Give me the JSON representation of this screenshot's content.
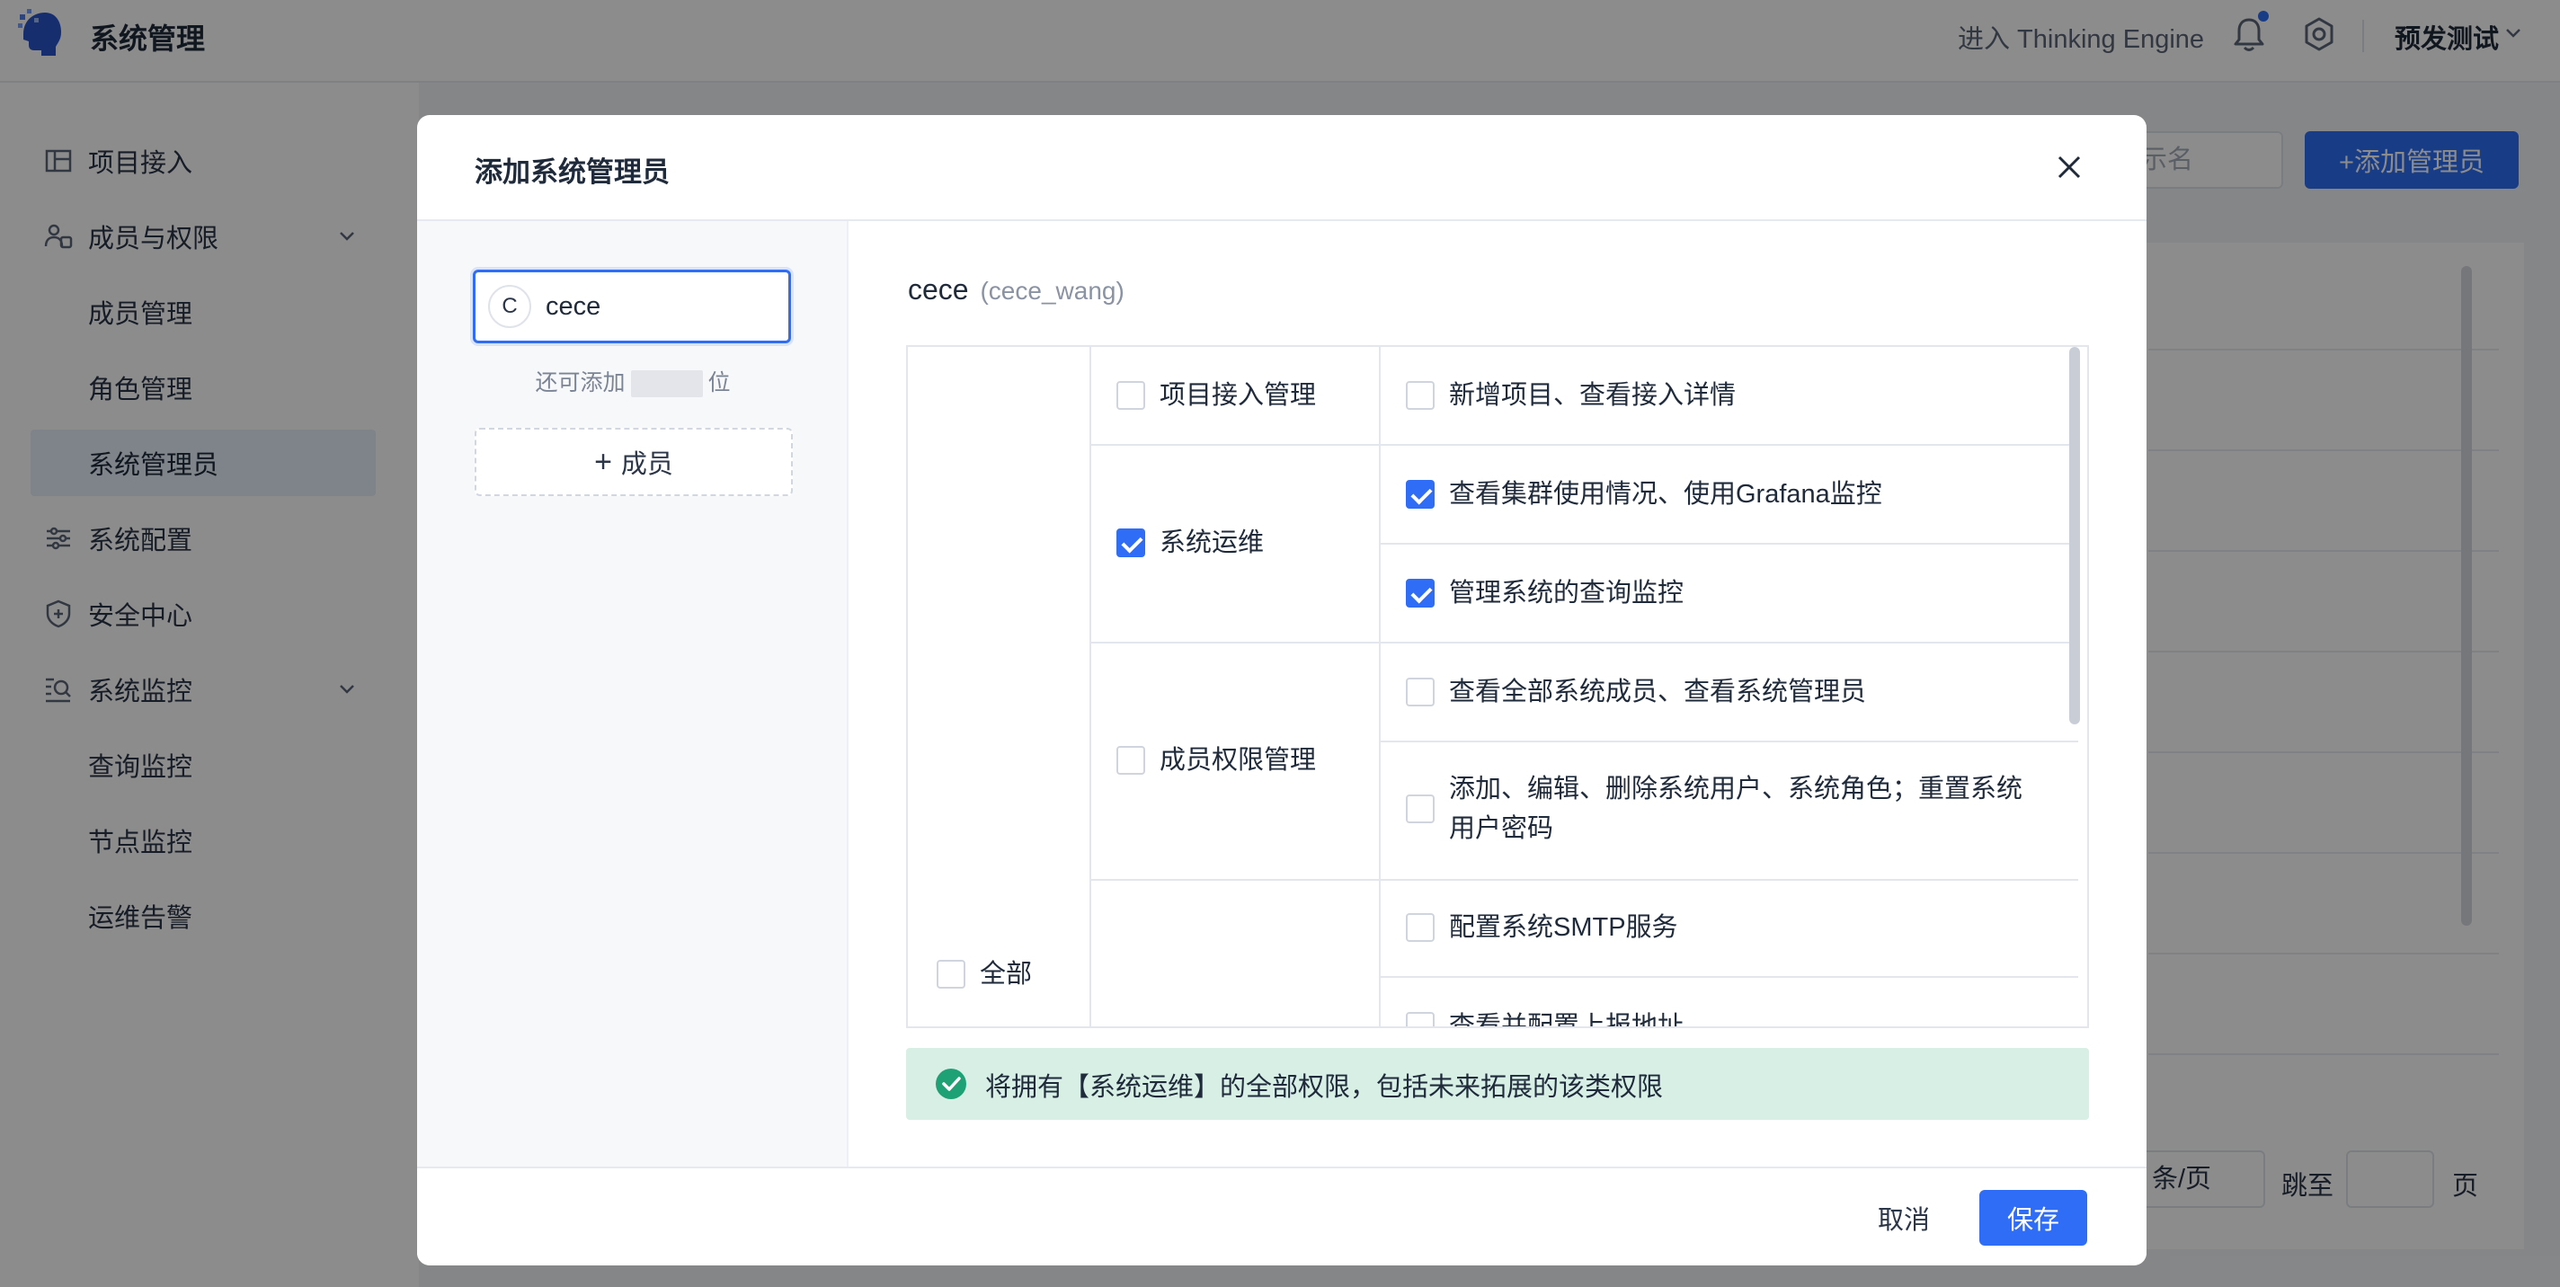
{
  "header": {
    "app_title": "系统管理",
    "enter_engine": "进入 Thinking Engine",
    "env_name": "预发测试"
  },
  "sidebar": {
    "items": [
      {
        "label": "项目接入",
        "icon": "project-icon"
      },
      {
        "label": "成员与权限",
        "icon": "members-icon"
      },
      {
        "label": "成员管理"
      },
      {
        "label": "角色管理"
      },
      {
        "label": "系统管理员"
      },
      {
        "label": "系统配置",
        "icon": "sliders-icon"
      },
      {
        "label": "安全中心",
        "icon": "shield-icon"
      },
      {
        "label": "系统监控",
        "icon": "monitor-icon"
      },
      {
        "label": "查询监控"
      },
      {
        "label": "节点监控"
      },
      {
        "label": "运维告警"
      }
    ],
    "active": "系统管理员"
  },
  "background": {
    "search_placeholder": "示名",
    "add_admin_button": "+添加管理员",
    "page_size": "条/页",
    "jump_to": "跳至",
    "page": "页"
  },
  "modal": {
    "title": "添加系统管理员",
    "member": {
      "avatar_letter": "C",
      "name": "cece"
    },
    "quota_prefix": "还可添加",
    "quota_suffix": "位",
    "add_member_label": "成员",
    "user_display_name": "cece",
    "user_account": "(cece_wang)",
    "permissions": {
      "all_label": "全部",
      "all_checked": false,
      "groups": [
        {
          "label": "项目接入管理",
          "checked": false,
          "items": [
            {
              "label": "新增项目、查看接入详情",
              "checked": false
            }
          ]
        },
        {
          "label": "系统运维",
          "checked": true,
          "items": [
            {
              "label": "查看集群使用情况、使用Grafana监控",
              "checked": true
            },
            {
              "label": "管理系统的查询监控",
              "checked": true
            }
          ]
        },
        {
          "label": "成员权限管理",
          "checked": false,
          "items": [
            {
              "label": "查看全部系统成员、查看系统管理员",
              "checked": false
            },
            {
              "label": "添加、编辑、删除系统用户、系统角色；重置系统",
              "checked": false
            },
            {
              "label": "用户密码",
              "checked": false
            }
          ]
        },
        {
          "label": "",
          "checked": false,
          "items": [
            {
              "label": "配置系统SMTP服务",
              "checked": false
            },
            {
              "label": "查看并配置上报地址",
              "checked": false
            }
          ]
        }
      ]
    },
    "notice": "将拥有【系统运维】的全部权限，包括未来拓展的该类权限",
    "cancel_label": "取消",
    "save_label": "保存"
  },
  "colors": {
    "primary": "#2f6df6",
    "notice_bg": "#d7efe5",
    "notice_icon": "#1fa176",
    "sidebar_active_bg": "#e8eefb"
  }
}
